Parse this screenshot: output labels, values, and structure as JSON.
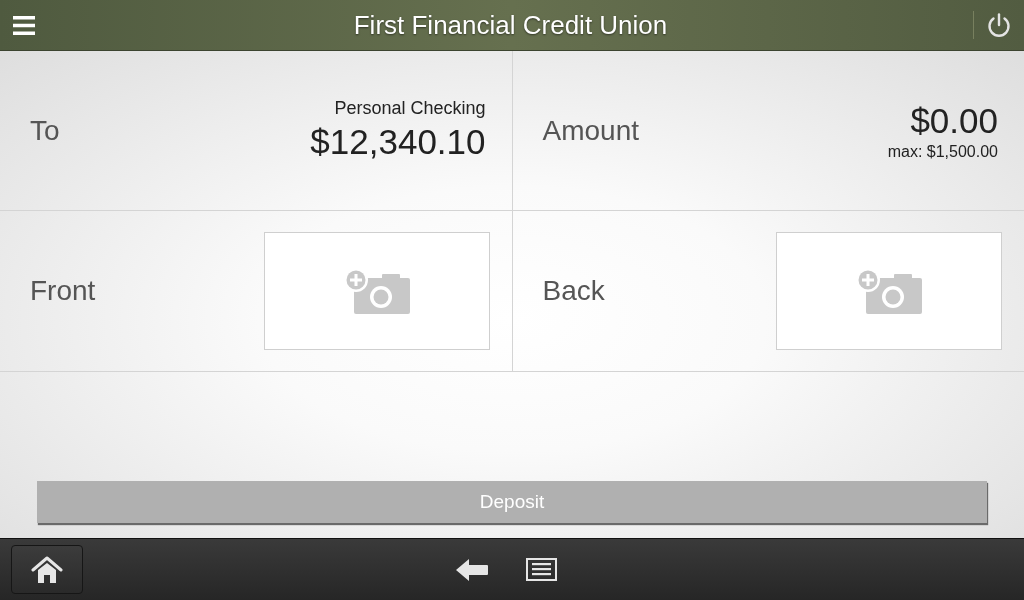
{
  "header": {
    "title": "First Financial Credit Union"
  },
  "fields": [
    {
      "kind": "account",
      "label": "To",
      "account_name": "Personal Checking",
      "balance": "$12,340.10"
    },
    {
      "kind": "amount",
      "label": "Amount",
      "value": "$0.00",
      "limit": "max: $1,500.00"
    }
  ],
  "photos": [
    {
      "label": "Front"
    },
    {
      "label": "Back"
    }
  ],
  "deposit_button": {
    "label": "Deposit",
    "disabled": true
  }
}
